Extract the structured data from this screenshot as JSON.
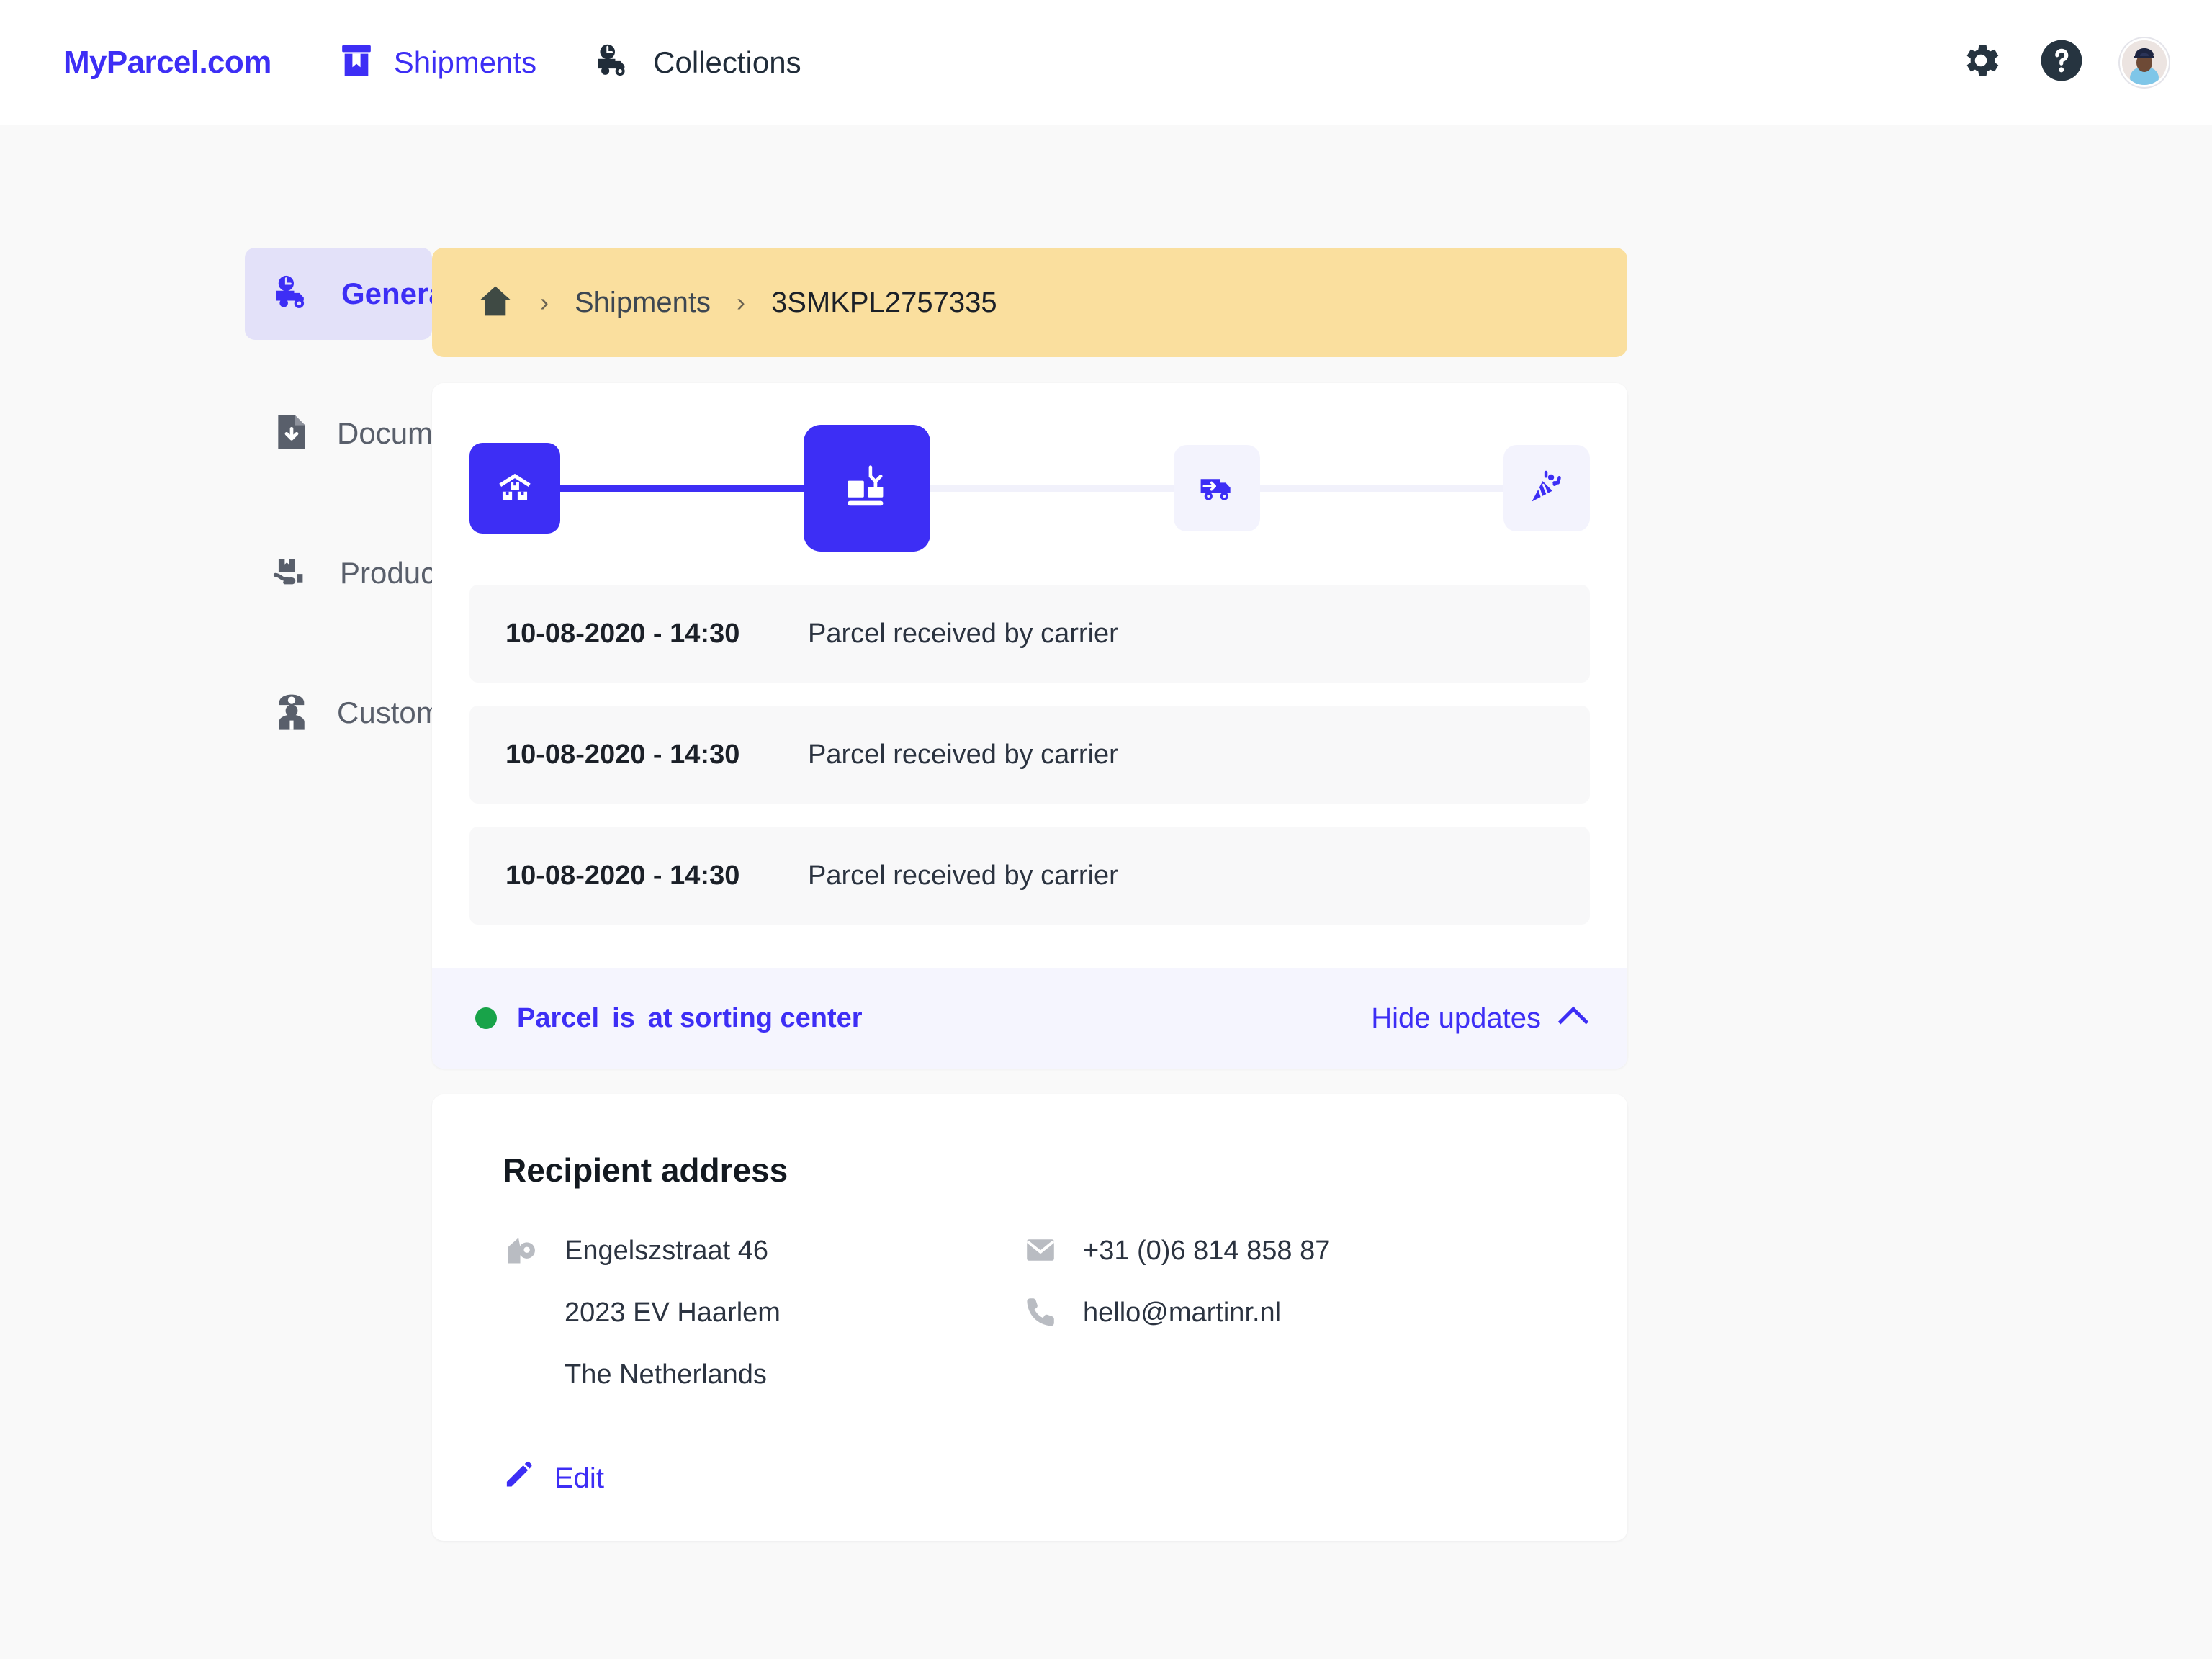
{
  "brand": {
    "name": "MyParcel",
    "suffix": ".com"
  },
  "topnav": {
    "items": [
      {
        "label": "Shipments",
        "icon": "shipments-box-icon",
        "active": true
      },
      {
        "label": "Collections",
        "icon": "collections-truck-clock-icon",
        "active": false
      }
    ],
    "actions": [
      {
        "name": "settings",
        "icon": "gear-icon"
      },
      {
        "name": "help",
        "icon": "question-mark-circle-icon"
      },
      {
        "name": "account",
        "icon": "avatar"
      }
    ]
  },
  "sidebar": {
    "items": [
      {
        "label": "General info",
        "icon": "truck-clock-icon",
        "active": true
      },
      {
        "label": "Documents",
        "icon": "document-download-icon",
        "active": false
      },
      {
        "label": "Products",
        "icon": "hand-box-icon",
        "active": false
      },
      {
        "label": "Customs",
        "icon": "customs-officer-icon",
        "active": false
      }
    ]
  },
  "breadcrumb": {
    "home_icon": "home-icon",
    "separator": "›",
    "items": [
      {
        "label": "Shipments"
      },
      {
        "label": "3SMKPL2757335"
      }
    ]
  },
  "tracking": {
    "steps": [
      {
        "name": "registered",
        "icon": "warehouse-parcels-icon",
        "state": "done"
      },
      {
        "name": "sorting-center",
        "icon": "sorting-center-icon",
        "state": "current"
      },
      {
        "name": "out-for-delivery",
        "icon": "delivery-truck-icon",
        "state": "todo"
      },
      {
        "name": "delivered",
        "icon": "party-popper-icon",
        "state": "todo"
      }
    ],
    "events": [
      {
        "time": "10-08-2020 - 14:30",
        "description": "Parcel received by carrier"
      },
      {
        "time": "10-08-2020 - 14:30",
        "description": "Parcel received by carrier"
      },
      {
        "time": "10-08-2020 - 14:30",
        "description": "Parcel received by carrier"
      }
    ],
    "status": {
      "prefix": "Parcel",
      "verb": "is",
      "state": "at sorting center",
      "dot_color": "#18a349"
    },
    "toggle": {
      "label": "Hide updates",
      "icon": "chevron-up-icon"
    }
  },
  "recipient": {
    "title": "Recipient address",
    "address": {
      "icon": "address-pin-icon",
      "street": "Engelszstraat 46",
      "postal_city": "2023 EV Haarlem",
      "country": "The Netherlands"
    },
    "contact": {
      "phone": {
        "icon": "mail-icon",
        "value": "+31 (0)6 814 858 87"
      },
      "email": {
        "icon": "phone-icon",
        "value": "hello@martinr.nl"
      }
    },
    "edit": {
      "label": "Edit",
      "icon": "pencil-icon"
    }
  },
  "colors": {
    "primary": "#3d2ef5",
    "breadcrumb_bg": "#fadf9e",
    "status_bg": "#f5f5fe",
    "active_nav_bg": "#e3e1f9",
    "page_bg": "#f9f9f9",
    "success": "#18a349"
  }
}
